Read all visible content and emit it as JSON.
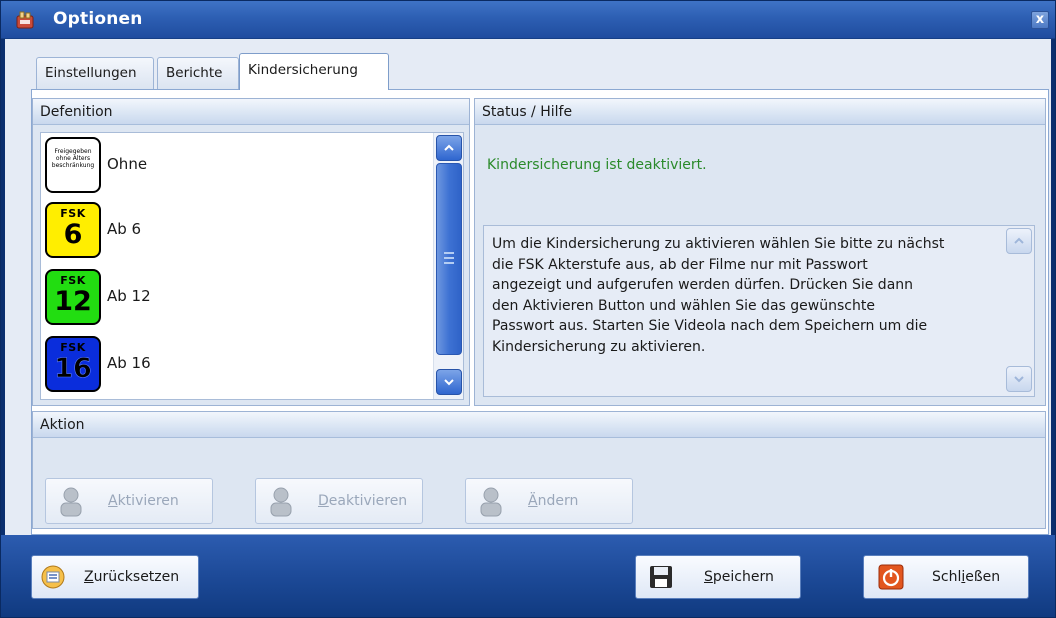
{
  "window": {
    "title": "Optionen",
    "close_label": "x"
  },
  "tabs": [
    {
      "label": "Einstellungen",
      "active": false
    },
    {
      "label": "Berichte",
      "active": false
    },
    {
      "label": "Kindersicherung",
      "active": true
    }
  ],
  "definition": {
    "header": "Defenition",
    "items": [
      {
        "label": "Ohne",
        "badge_top": "",
        "badge_num": "",
        "badge_text": "Freigegeben ohne Alters beschränkung",
        "badge_color": "#ffffff"
      },
      {
        "label": "Ab 6",
        "badge_top": "FSK",
        "badge_num": "6",
        "badge_color": "#ffee00"
      },
      {
        "label": "Ab 12",
        "badge_top": "FSK",
        "badge_num": "12",
        "badge_color": "#22dd11"
      },
      {
        "label": "Ab 16",
        "badge_top": "FSK",
        "badge_num": "16",
        "badge_color": "#0a2ddc"
      }
    ]
  },
  "status": {
    "header": "Status / Hilfe",
    "state_text": "Kindersicherung ist deaktiviert.",
    "state_color": "#2a8a2a",
    "help_lines": [
      "Um die Kindersicherung zu aktivieren wählen Sie bitte zu nächst",
      "die FSK Akterstufe aus, ab der Filme nur mit Passwort",
      "angezeigt und aufgerufen werden dürfen. Drücken Sie dann",
      "den Aktivieren Button und wählen Sie das gewünschte",
      "Passwort aus. Starten Sie Videola nach dem Speichern um die",
      "Kindersicherung zu aktivieren."
    ]
  },
  "aktion": {
    "header": "Aktion",
    "buttons": [
      {
        "prefix": "",
        "mnemonic": "A",
        "rest": "ktivieren",
        "enabled": false
      },
      {
        "prefix": "",
        "mnemonic": "D",
        "rest": "eaktivieren",
        "enabled": false
      },
      {
        "prefix": "",
        "mnemonic": "Ä",
        "rest": "ndern",
        "enabled": false
      }
    ]
  },
  "bottom": {
    "reset": {
      "mnemonic": "Z",
      "rest": "urücksetzen"
    },
    "save": {
      "mnemonic": "S",
      "rest": "peichern"
    },
    "close": {
      "prefix": "Schl",
      "mnemonic": "i",
      "rest": "eßen"
    }
  }
}
